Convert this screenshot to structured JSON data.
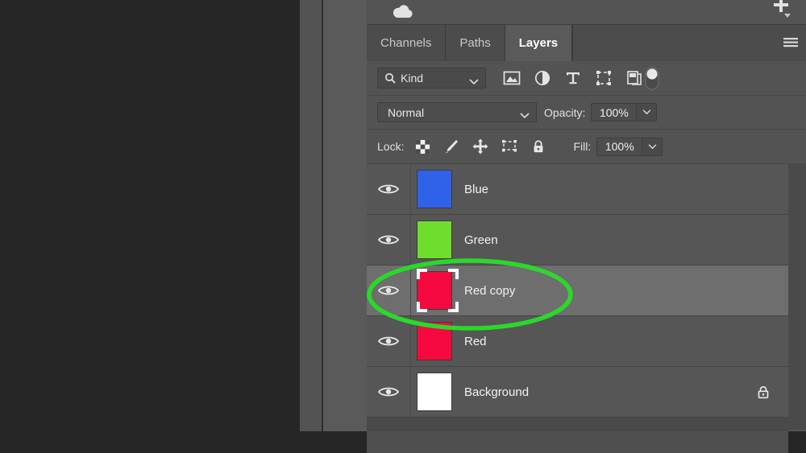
{
  "panel": {
    "cloud_icon": "cloud-icon",
    "add_icon": "plus-dropdown-icon",
    "menu_icon": "panel-menu-icon",
    "tabs": [
      {
        "label": "Channels",
        "active": false
      },
      {
        "label": "Paths",
        "active": false
      },
      {
        "label": "Layers",
        "active": true
      }
    ]
  },
  "filter": {
    "search_icon": "search-icon",
    "kind_label": "Kind",
    "kind_chevron": "chevron-down-icon",
    "type_filters": [
      {
        "name": "filter-pixel-layers-icon"
      },
      {
        "name": "filter-adjustment-layers-icon"
      },
      {
        "name": "filter-type-layers-icon"
      },
      {
        "name": "filter-shape-layers-icon"
      },
      {
        "name": "filter-smart-object-layers-icon"
      }
    ],
    "toggle": "filter-enable-toggle"
  },
  "blend": {
    "mode": "Normal",
    "mode_chevron": "chevron-down-icon",
    "opacity_label": "Opacity:",
    "opacity_value": "100%",
    "opacity_stepper": "chevron-down-icon"
  },
  "lock": {
    "label": "Lock:",
    "icons": [
      {
        "name": "lock-transparent-pixels-icon"
      },
      {
        "name": "lock-image-pixels-icon"
      },
      {
        "name": "lock-position-icon"
      },
      {
        "name": "lock-artboard-nesting-icon"
      },
      {
        "name": "lock-all-icon"
      }
    ],
    "fill_label": "Fill:",
    "fill_value": "100%",
    "fill_stepper": "chevron-down-icon"
  },
  "layers": [
    {
      "name": "Blue",
      "color": "#2f62e8",
      "visible": true,
      "selected": false,
      "locked": false
    },
    {
      "name": "Green",
      "color": "#6fdd2d",
      "visible": true,
      "selected": false,
      "locked": false
    },
    {
      "name": "Red copy",
      "color": "#f5093f",
      "visible": true,
      "selected": true,
      "locked": false
    },
    {
      "name": "Red",
      "color": "#f5093f",
      "visible": true,
      "selected": false,
      "locked": false
    },
    {
      "name": "Background",
      "color": "#ffffff",
      "visible": true,
      "selected": false,
      "locked": true
    }
  ],
  "annotation": {
    "shape": "ellipse",
    "color": "#2bd82b",
    "target_layer": "Red copy"
  },
  "colors": {
    "panel_bg": "#535353",
    "row_bg": "#565656",
    "row_selected_bg": "#6e6e6e",
    "tab_active_bg": "#5a5a5a",
    "canvas_bg": "#262626",
    "text": "#f2f2f2"
  }
}
